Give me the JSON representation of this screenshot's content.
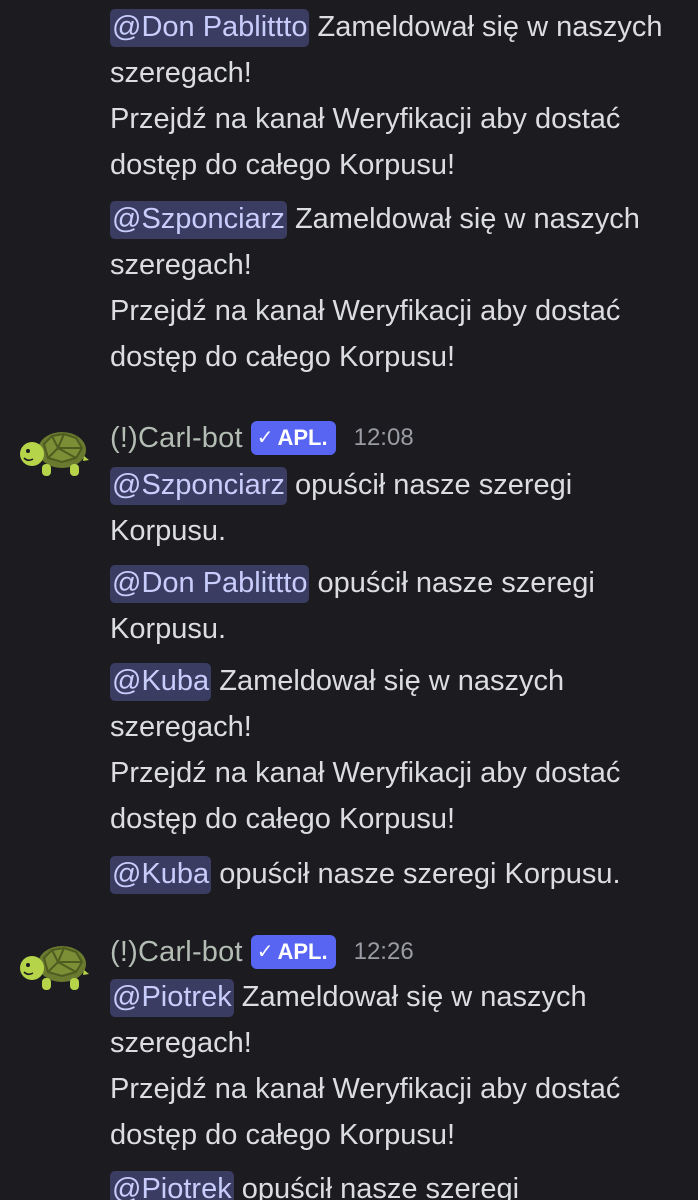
{
  "messages_top": [
    {
      "mention": "@Don Pablittto",
      "text": " Zameldował się w naszych szeregach!",
      "line2": "Przejdź na kanał Weryfikacji aby dostać dostęp do całego Korpusu!"
    },
    {
      "mention": "@Szponciarz",
      "text": " Zameldował się w naszych szeregach!",
      "line2": "Przejdź na kanał Weryfikacji aby dostać dostęp do całego Korpusu!"
    }
  ],
  "group1": {
    "username": "(!)Carl-bot",
    "badge": "APL.",
    "badge_check": "✓",
    "time": "12:08",
    "avatar_icon": "turtle-icon",
    "messages": [
      {
        "mention": "@Szponciarz",
        "text": " opuścił nasze szeregi Korpusu."
      },
      {
        "mention": "@Don Pablittto",
        "text": " opuścił nasze szeregi Korpusu."
      },
      {
        "mention": "@Kuba",
        "text": " Zameldował się w naszych szeregach!",
        "line2": "Przejdź na kanał Weryfikacji aby dostać dostęp do całego Korpusu!"
      },
      {
        "mention": "@Kuba",
        "text": " opuścił nasze szeregi Korpusu."
      }
    ]
  },
  "group2": {
    "username": "(!)Carl-bot",
    "badge": "APL.",
    "badge_check": "✓",
    "time": "12:26",
    "avatar_icon": "turtle-icon",
    "messages": [
      {
        "mention": "@Piotrek",
        "text": " Zameldował się w naszych szeregach!",
        "line2": "Przejdź na kanał Weryfikacji aby dostać dostęp do całego Korpusu!"
      },
      {
        "mention": "@Piotrek",
        "text": " opuścił nasze szeregi"
      }
    ]
  },
  "colors": {
    "background": "#1b1b20",
    "mention_bg": "#3b3c62",
    "mention_text": "#c9cdfb",
    "badge_bg": "#5865f2",
    "username": "#b3bdb4",
    "text": "#dcdde1"
  }
}
